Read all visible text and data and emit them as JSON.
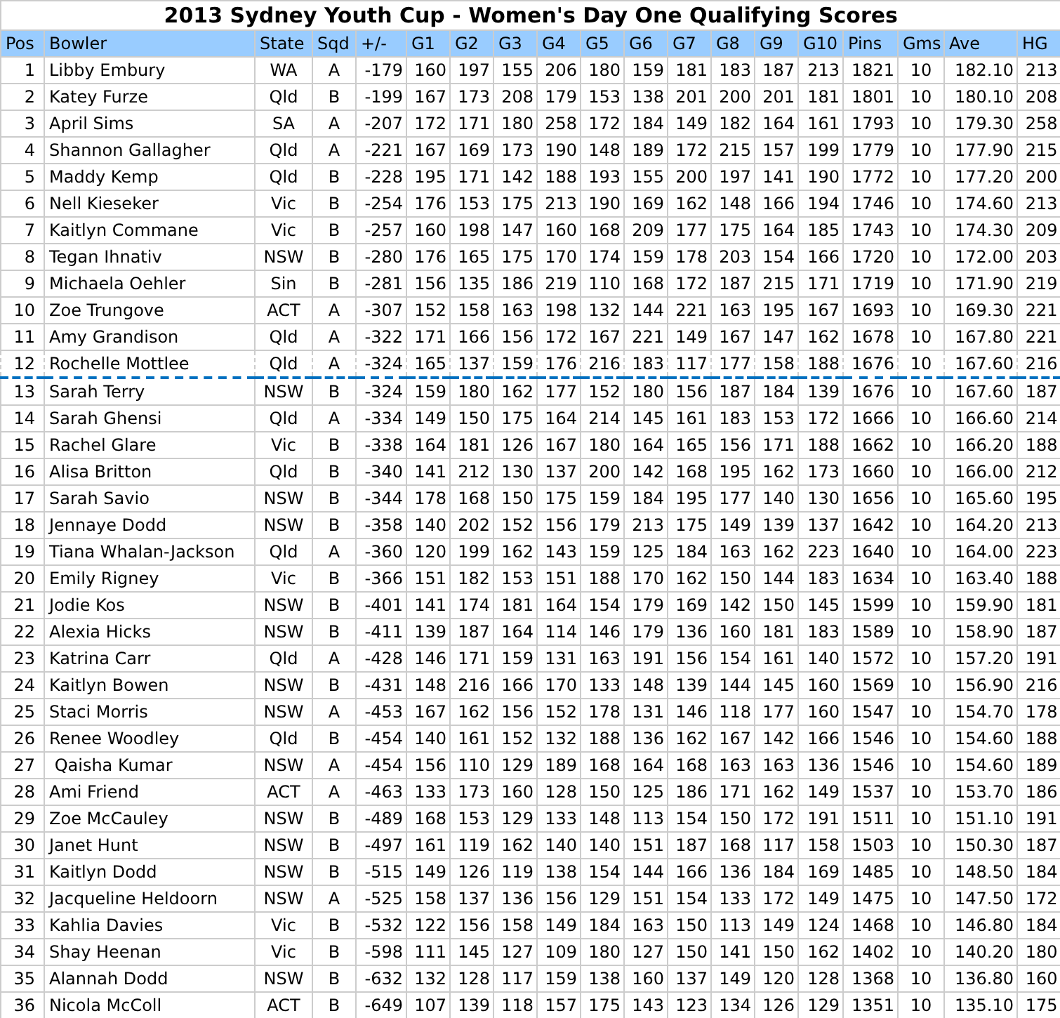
{
  "title": "2013 Sydney Youth Cup - Women's Day One Qualifying Scores",
  "columns": [
    "Pos",
    "Bowler",
    "State",
    "Sqd",
    "+/-",
    "G1",
    "G2",
    "G3",
    "G4",
    "G5",
    "G6",
    "G7",
    "G8",
    "G9",
    "G10",
    "Pins",
    "Gms",
    "Ave",
    "HG"
  ],
  "rows": [
    {
      "cut_line": false,
      "cells": [
        "1",
        "Libby Embury",
        "WA",
        "A",
        "-179",
        "160",
        "197",
        "155",
        "206",
        "180",
        "159",
        "181",
        "183",
        "187",
        "213",
        "1821",
        "10",
        "182.10",
        "213"
      ]
    },
    {
      "cut_line": false,
      "cells": [
        "2",
        "Katey Furze",
        "Qld",
        "B",
        "-199",
        "167",
        "173",
        "208",
        "179",
        "153",
        "138",
        "201",
        "200",
        "201",
        "181",
        "1801",
        "10",
        "180.10",
        "208"
      ]
    },
    {
      "cut_line": false,
      "cells": [
        "3",
        "April Sims",
        "SA",
        "A",
        "-207",
        "172",
        "171",
        "180",
        "258",
        "172",
        "184",
        "149",
        "182",
        "164",
        "161",
        "1793",
        "10",
        "179.30",
        "258"
      ]
    },
    {
      "cut_line": false,
      "cells": [
        "4",
        "Shannon Gallagher",
        "Qld",
        "A",
        "-221",
        "167",
        "169",
        "173",
        "190",
        "148",
        "189",
        "172",
        "215",
        "157",
        "199",
        "1779",
        "10",
        "177.90",
        "215"
      ]
    },
    {
      "cut_line": false,
      "cells": [
        "5",
        "Maddy Kemp",
        "Qld",
        "B",
        "-228",
        "195",
        "171",
        "142",
        "188",
        "193",
        "155",
        "200",
        "197",
        "141",
        "190",
        "1772",
        "10",
        "177.20",
        "200"
      ]
    },
    {
      "cut_line": false,
      "cells": [
        "6",
        "Nell Kieseker",
        "Vic",
        "B",
        "-254",
        "176",
        "153",
        "175",
        "213",
        "190",
        "169",
        "162",
        "148",
        "166",
        "194",
        "1746",
        "10",
        "174.60",
        "213"
      ]
    },
    {
      "cut_line": false,
      "cells": [
        "7",
        "Kaitlyn Commane",
        "Vic",
        "B",
        "-257",
        "160",
        "198",
        "147",
        "160",
        "168",
        "209",
        "177",
        "175",
        "164",
        "185",
        "1743",
        "10",
        "174.30",
        "209"
      ]
    },
    {
      "cut_line": false,
      "cells": [
        "8",
        "Tegan Ihnativ",
        "NSW",
        "B",
        "-280",
        "176",
        "165",
        "175",
        "170",
        "174",
        "159",
        "178",
        "203",
        "154",
        "166",
        "1720",
        "10",
        "172.00",
        "203"
      ]
    },
    {
      "cut_line": false,
      "cells": [
        "9",
        "Michaela Oehler",
        "Sin",
        "B",
        "-281",
        "156",
        "135",
        "186",
        "219",
        "110",
        "168",
        "172",
        "187",
        "215",
        "171",
        "1719",
        "10",
        "171.90",
        "219"
      ]
    },
    {
      "cut_line": false,
      "cells": [
        "10",
        "Zoe Trungove",
        "ACT",
        "A",
        "-307",
        "152",
        "158",
        "163",
        "198",
        "132",
        "144",
        "221",
        "163",
        "195",
        "167",
        "1693",
        "10",
        "169.30",
        "221"
      ]
    },
    {
      "cut_line": false,
      "cells": [
        "11",
        "Amy Grandison",
        "Qld",
        "A",
        "-322",
        "171",
        "166",
        "156",
        "172",
        "167",
        "221",
        "149",
        "167",
        "147",
        "162",
        "1678",
        "10",
        "167.80",
        "221"
      ]
    },
    {
      "cut_line": true,
      "cells": [
        "12",
        "Rochelle Mottlee",
        "Qld",
        "A",
        "-324",
        "165",
        "137",
        "159",
        "176",
        "216",
        "183",
        "117",
        "177",
        "158",
        "188",
        "1676",
        "10",
        "167.60",
        "216"
      ]
    },
    {
      "cut_line": false,
      "cells": [
        "13",
        "Sarah Terry",
        "NSW",
        "B",
        "-324",
        "159",
        "180",
        "162",
        "177",
        "152",
        "180",
        "156",
        "187",
        "184",
        "139",
        "1676",
        "10",
        "167.60",
        "187"
      ]
    },
    {
      "cut_line": false,
      "cells": [
        "14",
        "Sarah Ghensi",
        "Qld",
        "A",
        "-334",
        "149",
        "150",
        "175",
        "164",
        "214",
        "145",
        "161",
        "183",
        "153",
        "172",
        "1666",
        "10",
        "166.60",
        "214"
      ]
    },
    {
      "cut_line": false,
      "cells": [
        "15",
        "Rachel Glare",
        "Vic",
        "B",
        "-338",
        "164",
        "181",
        "126",
        "167",
        "180",
        "164",
        "165",
        "156",
        "171",
        "188",
        "1662",
        "10",
        "166.20",
        "188"
      ]
    },
    {
      "cut_line": false,
      "cells": [
        "16",
        "Alisa Britton",
        "Qld",
        "B",
        "-340",
        "141",
        "212",
        "130",
        "137",
        "200",
        "142",
        "168",
        "195",
        "162",
        "173",
        "1660",
        "10",
        "166.00",
        "212"
      ]
    },
    {
      "cut_line": false,
      "cells": [
        "17",
        "Sarah Savio",
        "NSW",
        "B",
        "-344",
        "178",
        "168",
        "150",
        "175",
        "159",
        "184",
        "195",
        "177",
        "140",
        "130",
        "1656",
        "10",
        "165.60",
        "195"
      ]
    },
    {
      "cut_line": false,
      "cells": [
        "18",
        "Jennaye Dodd",
        "NSW",
        "B",
        "-358",
        "140",
        "202",
        "152",
        "156",
        "179",
        "213",
        "175",
        "149",
        "139",
        "137",
        "1642",
        "10",
        "164.20",
        "213"
      ]
    },
    {
      "cut_line": false,
      "cells": [
        "19",
        "Tiana Whalan-Jackson",
        "Qld",
        "A",
        "-360",
        "120",
        "199",
        "162",
        "143",
        "159",
        "125",
        "184",
        "163",
        "162",
        "223",
        "1640",
        "10",
        "164.00",
        "223"
      ]
    },
    {
      "cut_line": false,
      "cells": [
        "20",
        "Emily Rigney",
        "Vic",
        "B",
        "-366",
        "151",
        "182",
        "153",
        "151",
        "188",
        "170",
        "162",
        "150",
        "144",
        "183",
        "1634",
        "10",
        "163.40",
        "188"
      ]
    },
    {
      "cut_line": false,
      "cells": [
        "21",
        "Jodie Kos",
        "NSW",
        "B",
        "-401",
        "141",
        "174",
        "181",
        "164",
        "154",
        "179",
        "169",
        "142",
        "150",
        "145",
        "1599",
        "10",
        "159.90",
        "181"
      ]
    },
    {
      "cut_line": false,
      "cells": [
        "22",
        "Alexia Hicks",
        "NSW",
        "B",
        "-411",
        "139",
        "187",
        "164",
        "114",
        "146",
        "179",
        "136",
        "160",
        "181",
        "183",
        "1589",
        "10",
        "158.90",
        "187"
      ]
    },
    {
      "cut_line": false,
      "cells": [
        "23",
        "Katrina Carr",
        "Qld",
        "A",
        "-428",
        "146",
        "171",
        "159",
        "131",
        "163",
        "191",
        "156",
        "154",
        "161",
        "140",
        "1572",
        "10",
        "157.20",
        "191"
      ]
    },
    {
      "cut_line": false,
      "cells": [
        "24",
        "Kaitlyn Bowen",
        "NSW",
        "B",
        "-431",
        "148",
        "216",
        "166",
        "170",
        "133",
        "148",
        "139",
        "144",
        "145",
        "160",
        "1569",
        "10",
        "156.90",
        "216"
      ]
    },
    {
      "cut_line": false,
      "cells": [
        "25",
        "Staci Morris",
        "NSW",
        "A",
        "-453",
        "167",
        "162",
        "156",
        "152",
        "178",
        "131",
        "146",
        "118",
        "177",
        "160",
        "1547",
        "10",
        "154.70",
        "178"
      ]
    },
    {
      "cut_line": false,
      "cells": [
        "26",
        "Renee Woodley",
        "Qld",
        "B",
        "-454",
        "140",
        "161",
        "152",
        "132",
        "188",
        "136",
        "162",
        "167",
        "142",
        "166",
        "1546",
        "10",
        "154.60",
        "188"
      ]
    },
    {
      "cut_line": false,
      "cells": [
        "27",
        " Qaisha Kumar",
        "NSW",
        "A",
        "-454",
        "156",
        "110",
        "129",
        "189",
        "168",
        "164",
        "168",
        "163",
        "163",
        "136",
        "1546",
        "10",
        "154.60",
        "189"
      ]
    },
    {
      "cut_line": false,
      "cells": [
        "28",
        "Ami Friend",
        "ACT",
        "A",
        "-463",
        "133",
        "173",
        "160",
        "128",
        "150",
        "125",
        "186",
        "171",
        "162",
        "149",
        "1537",
        "10",
        "153.70",
        "186"
      ]
    },
    {
      "cut_line": false,
      "cells": [
        "29",
        "Zoe McCauley",
        "NSW",
        "B",
        "-489",
        "168",
        "153",
        "129",
        "133",
        "148",
        "113",
        "154",
        "150",
        "172",
        "191",
        "1511",
        "10",
        "151.10",
        "191"
      ]
    },
    {
      "cut_line": false,
      "cells": [
        "30",
        "Janet Hunt",
        "NSW",
        "B",
        "-497",
        "161",
        "119",
        "162",
        "140",
        "140",
        "151",
        "187",
        "168",
        "117",
        "158",
        "1503",
        "10",
        "150.30",
        "187"
      ]
    },
    {
      "cut_line": false,
      "cells": [
        "31",
        "Kaitlyn Dodd",
        "NSW",
        "B",
        "-515",
        "149",
        "126",
        "119",
        "138",
        "154",
        "144",
        "166",
        "136",
        "184",
        "169",
        "1485",
        "10",
        "148.50",
        "184"
      ]
    },
    {
      "cut_line": false,
      "cells": [
        "32",
        "Jacqueline Heldoorn",
        "NSW",
        "A",
        "-525",
        "158",
        "137",
        "136",
        "156",
        "129",
        "151",
        "154",
        "133",
        "172",
        "149",
        "1475",
        "10",
        "147.50",
        "172"
      ]
    },
    {
      "cut_line": false,
      "cells": [
        "33",
        "Kahlia Davies",
        "Vic",
        "B",
        "-532",
        "122",
        "156",
        "158",
        "149",
        "184",
        "163",
        "150",
        "113",
        "149",
        "124",
        "1468",
        "10",
        "146.80",
        "184"
      ]
    },
    {
      "cut_line": false,
      "cells": [
        "34",
        "Shay Heenan",
        "Vic",
        "B",
        "-598",
        "111",
        "145",
        "127",
        "109",
        "180",
        "127",
        "150",
        "141",
        "150",
        "162",
        "1402",
        "10",
        "140.20",
        "180"
      ]
    },
    {
      "cut_line": false,
      "cells": [
        "35",
        "Alannah Dodd",
        "NSW",
        "B",
        "-632",
        "132",
        "128",
        "117",
        "159",
        "138",
        "160",
        "137",
        "149",
        "120",
        "128",
        "1368",
        "10",
        "136.80",
        "160"
      ]
    },
    {
      "cut_line": false,
      "cells": [
        "36",
        "Nicola McColl",
        "ACT",
        "B",
        "-649",
        "107",
        "139",
        "118",
        "157",
        "175",
        "143",
        "123",
        "134",
        "126",
        "129",
        "1351",
        "10",
        "135.10",
        "175"
      ]
    }
  ]
}
